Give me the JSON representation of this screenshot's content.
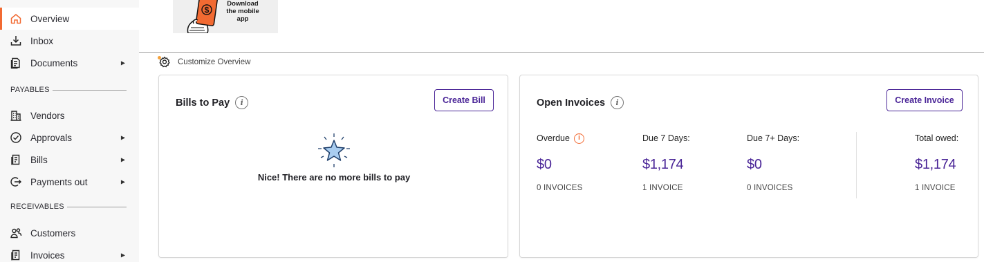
{
  "sidebar": {
    "items": [
      {
        "label": "Overview",
        "icon": "home-icon",
        "active": true
      },
      {
        "label": "Inbox",
        "icon": "download-icon"
      },
      {
        "label": "Documents",
        "icon": "document-icon",
        "expandable": true
      },
      {
        "label": "Vendors",
        "icon": "building-icon"
      },
      {
        "label": "Approvals",
        "icon": "check-circle-icon",
        "expandable": true
      },
      {
        "label": "Bills",
        "icon": "receipt-icon",
        "expandable": true
      },
      {
        "label": "Payments out",
        "icon": "payment-out-icon",
        "expandable": true
      },
      {
        "label": "Customers",
        "icon": "users-icon"
      },
      {
        "label": "Invoices",
        "icon": "invoice-icon",
        "expandable": true
      }
    ],
    "sections": {
      "payables": "PAYABLES",
      "receivables": "RECEIVABLES"
    },
    "caret": "▶"
  },
  "banner": {
    "text": "Download the mobile app",
    "icon": "dollar-phone-icon"
  },
  "customize": {
    "label": "Customize Overview"
  },
  "bills_card": {
    "title": "Bills to Pay",
    "button": "Create Bill",
    "empty_message": "Nice! There are no more bills to pay"
  },
  "invoices_card": {
    "title": "Open Invoices",
    "button": "Create Invoice",
    "stats": [
      {
        "label": "Overdue",
        "value": "$0",
        "count": "0 INVOICES"
      },
      {
        "label": "Due 7 Days:",
        "value": "$1,174",
        "count": "1 INVOICE"
      },
      {
        "label": "Due 7+ Days:",
        "value": "$0",
        "count": "0 INVOICES"
      },
      {
        "label": "Total owed:",
        "value": "$1,174",
        "count": "1 INVOICE"
      }
    ]
  },
  "colors": {
    "accent": "#4a2597",
    "brand_orange": "#f26a32",
    "sidebar_bg": "#f7f7f7"
  }
}
